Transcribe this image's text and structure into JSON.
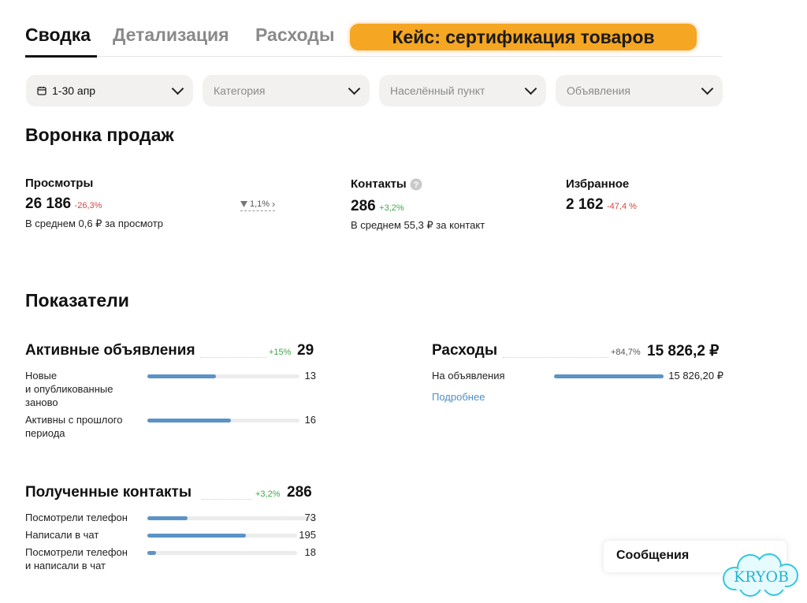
{
  "tabs": [
    {
      "label": "Сводка",
      "active": true
    },
    {
      "label": "Детализация",
      "active": false
    },
    {
      "label": "Расходы",
      "active": false
    }
  ],
  "case_badge": {
    "label": "Кейс: сертификация товаров",
    "color": "#f5a623"
  },
  "filters": [
    {
      "label": "1-30 апр",
      "icon": "calendar-icon",
      "placeholder": false
    },
    {
      "label": "Категория",
      "placeholder": true
    },
    {
      "label": "Населённый пункт",
      "placeholder": true
    },
    {
      "label": "Объявления",
      "placeholder": true
    }
  ],
  "funnel": {
    "title": "Воронка продаж",
    "views": {
      "label": "Просмотры",
      "value": "26 186",
      "delta": "-26,3%",
      "avg": "В среднем 0,6 ₽ за просмотр",
      "conversion": "1,1%"
    },
    "contacts": {
      "label": "Контакты",
      "value": "286",
      "delta": "+3,2%",
      "avg": "В среднем 55,3 ₽ за контакт"
    },
    "favorites": {
      "label": "Избранное",
      "value": "2 162",
      "delta": "-47,4 %"
    }
  },
  "indicators": {
    "title": "Показатели",
    "active_ads": {
      "title": "Активные объявления",
      "delta": "+15%",
      "total": "29",
      "rows": [
        {
          "label_lines": [
            "Новые",
            "и опубликованные",
            "заново"
          ],
          "value": "13",
          "fill": 0.45
        },
        {
          "label_lines": [
            "Активны с прошлого",
            "периода"
          ],
          "value": "16",
          "fill": 0.55
        }
      ]
    },
    "expenses": {
      "title": "Расходы",
      "delta": "+84,7%",
      "total": "15 826,2 ₽",
      "rows": [
        {
          "label_lines": [
            "На объявления"
          ],
          "value": "15 826,20 ₽",
          "fill": 1.0
        }
      ],
      "link": "Подробнее"
    },
    "contacts_received": {
      "title": "Полученные контакты",
      "delta": "+3,2%",
      "total": "286",
      "rows": [
        {
          "label_lines": [
            "Посмотрели телефон"
          ],
          "value": "73",
          "fill": 0.24
        },
        {
          "label_lines": [
            "Написали в чат"
          ],
          "value": "195",
          "fill": 0.66
        },
        {
          "label_lines": [
            "Посмотрели телефон",
            "и написали в чат"
          ],
          "value": "18",
          "fill": 0.06
        }
      ]
    }
  },
  "messages": {
    "label": "Сообщения"
  },
  "watermark": {
    "text": "KRYOB"
  },
  "colors": {
    "bar": "#5b93c7",
    "negative": "#d64545",
    "positive": "#3fa84a",
    "badge": "#f5a623"
  }
}
